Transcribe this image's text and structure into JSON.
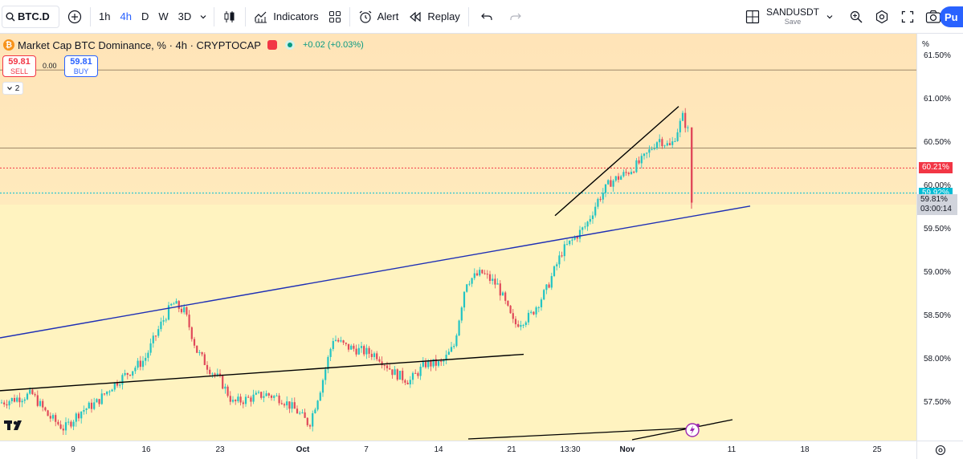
{
  "toolbar": {
    "symbol": "BTC.D",
    "timeframes": [
      "1h",
      "4h",
      "D",
      "W",
      "3D"
    ],
    "active_timeframe": "4h",
    "indicators_label": "Indicators",
    "alert_label": "Alert",
    "replay_label": "Replay",
    "layout_name": "SANDUSDT",
    "layout_save": "Save",
    "publish_label": "Pu"
  },
  "legend": {
    "coin_glyph": "₿",
    "title": "Market Cap BTC Dominance, % · 4h · CRYPTOCAP",
    "change": "+0.02 (+0.03%)",
    "sell_price": "59.81",
    "sell_label": "SELL",
    "spread": "0.00",
    "buy_price": "59.81",
    "buy_label": "BUY",
    "indicator_count": "2"
  },
  "price_axis": {
    "unit": "%",
    "ticks": [
      {
        "label": "61.50%",
        "value": 61.5
      },
      {
        "label": "61.00%",
        "value": 61.0
      },
      {
        "label": "60.50%",
        "value": 60.5
      },
      {
        "label": "60.00%",
        "value": 60.0
      },
      {
        "label": "59.50%",
        "value": 59.5
      },
      {
        "label": "59.00%",
        "value": 59.0
      },
      {
        "label": "58.50%",
        "value": 58.5
      },
      {
        "label": "58.00%",
        "value": 58.0
      },
      {
        "label": "57.50%",
        "value": 57.5
      }
    ],
    "tag_red": "60.21%",
    "tag_cyan": "59.92%",
    "tag_last": "59.81%",
    "tag_countdown": "03:00:14"
  },
  "time_axis": {
    "ticks": [
      {
        "label": "9",
        "bold": false
      },
      {
        "label": "16",
        "bold": false
      },
      {
        "label": "23",
        "bold": false
      },
      {
        "label": "Oct",
        "bold": true
      },
      {
        "label": "7",
        "bold": false
      },
      {
        "label": "14",
        "bold": false
      },
      {
        "label": "21",
        "bold": false
      },
      {
        "label": "13:30",
        "bold": false
      },
      {
        "label": "Nov",
        "bold": true
      },
      {
        "label": "11",
        "bold": false
      },
      {
        "label": "18",
        "bold": false
      },
      {
        "label": "25",
        "bold": false
      }
    ]
  },
  "chart_data": {
    "type": "candlestick",
    "ylim": [
      57.1,
      61.6
    ],
    "horizontal_lines": [
      {
        "value": 61.34,
        "color": "#9e8a6a",
        "style": "solid"
      },
      {
        "value": 60.44,
        "color": "#9e8a6a",
        "style": "solid"
      },
      {
        "value": 60.21,
        "color": "#f23645",
        "style": "dotted"
      },
      {
        "value": 59.92,
        "color": "#00bcd4",
        "style": "dotted"
      }
    ],
    "trendlines": [
      {
        "color": "#1e2fb5",
        "from": {
          "x": "start",
          "y": 58.25
        },
        "to": {
          "x": "Nov+5",
          "y": 59.77
        }
      },
      {
        "color": "#000000",
        "from": {
          "x": "start",
          "y": 57.64
        },
        "to": {
          "x": "Oct+25",
          "y": 58.06
        }
      },
      {
        "color": "#000000",
        "from": {
          "x": "Oct+28",
          "y": 59.66
        },
        "to": {
          "x": "Nov+4",
          "y": 60.92
        }
      }
    ],
    "close_path": [
      [
        0,
        57.5
      ],
      [
        20,
        57.55
      ],
      [
        40,
        57.6
      ],
      [
        60,
        57.35
      ],
      [
        80,
        57.2
      ],
      [
        100,
        57.4
      ],
      [
        120,
        57.5
      ],
      [
        140,
        57.7
      ],
      [
        160,
        57.85
      ],
      [
        180,
        58.0
      ],
      [
        200,
        58.4
      ],
      [
        215,
        58.65
      ],
      [
        230,
        58.55
      ],
      [
        245,
        58.1
      ],
      [
        260,
        57.9
      ],
      [
        275,
        57.75
      ],
      [
        290,
        57.5
      ],
      [
        310,
        57.55
      ],
      [
        330,
        57.6
      ],
      [
        350,
        57.55
      ],
      [
        370,
        57.4
      ],
      [
        385,
        57.25
      ],
      [
        400,
        57.7
      ],
      [
        415,
        58.25
      ],
      [
        430,
        58.15
      ],
      [
        450,
        58.1
      ],
      [
        470,
        58.05
      ],
      [
        490,
        57.85
      ],
      [
        510,
        57.75
      ],
      [
        530,
        57.95
      ],
      [
        550,
        57.95
      ],
      [
        565,
        58.15
      ],
      [
        580,
        58.9
      ],
      [
        600,
        59.0
      ],
      [
        620,
        58.85
      ],
      [
        640,
        58.4
      ],
      [
        660,
        58.5
      ],
      [
        680,
        58.8
      ],
      [
        700,
        59.25
      ],
      [
        715,
        59.4
      ],
      [
        730,
        59.55
      ],
      [
        745,
        59.85
      ],
      [
        760,
        60.05
      ],
      [
        780,
        60.15
      ],
      [
        800,
        60.3
      ],
      [
        820,
        60.55
      ],
      [
        835,
        60.45
      ],
      [
        850,
        60.8
      ],
      [
        858,
        60.6
      ],
      [
        862,
        59.81
      ]
    ]
  }
}
